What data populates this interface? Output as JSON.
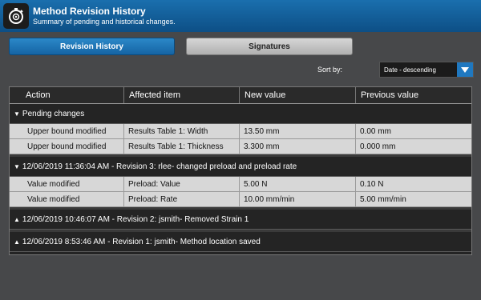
{
  "header": {
    "title": "Method Revision History",
    "subtitle": "Summary of pending and historical changes.",
    "app_icon": "stopwatch-gear-icon"
  },
  "tabs": [
    {
      "label": "Revision History",
      "active": true
    },
    {
      "label": "Signatures",
      "active": false
    }
  ],
  "sort": {
    "label": "Sort by:",
    "value": "Date - descending"
  },
  "table": {
    "columns": [
      "Action",
      "Affected item",
      "New value",
      "Previous value"
    ],
    "groups": [
      {
        "title": "Pending changes",
        "expanded": true,
        "rows": [
          [
            "Upper bound modified",
            "Results Table 1: Width",
            "13.50 mm",
            "0.00 mm"
          ],
          [
            "Upper bound modified",
            "Results Table 1: Thickness",
            "3.300 mm",
            "0.000 mm"
          ]
        ]
      },
      {
        "title": "12/06/2019 11:36:04 AM - Revision 3: rlee- changed preload and preload rate",
        "expanded": true,
        "rows": [
          [
            "Value modified",
            "Preload: Value",
            "5.00 N",
            "0.10 N"
          ],
          [
            "Value modified",
            "Preload: Rate",
            "10.00 mm/min",
            "5.00 mm/min"
          ]
        ]
      },
      {
        "title": "12/06/2019 10:46:07 AM - Revision 2: jsmith- Removed Strain 1",
        "expanded": false,
        "rows": []
      },
      {
        "title": "12/06/2019 8:53:46 AM - Revision 1: jsmith- Method location saved",
        "expanded": false,
        "rows": []
      }
    ]
  },
  "colors": {
    "accent": "#1f78c0",
    "header": "#0d4f86",
    "row_bg": "#d7d7d7"
  }
}
